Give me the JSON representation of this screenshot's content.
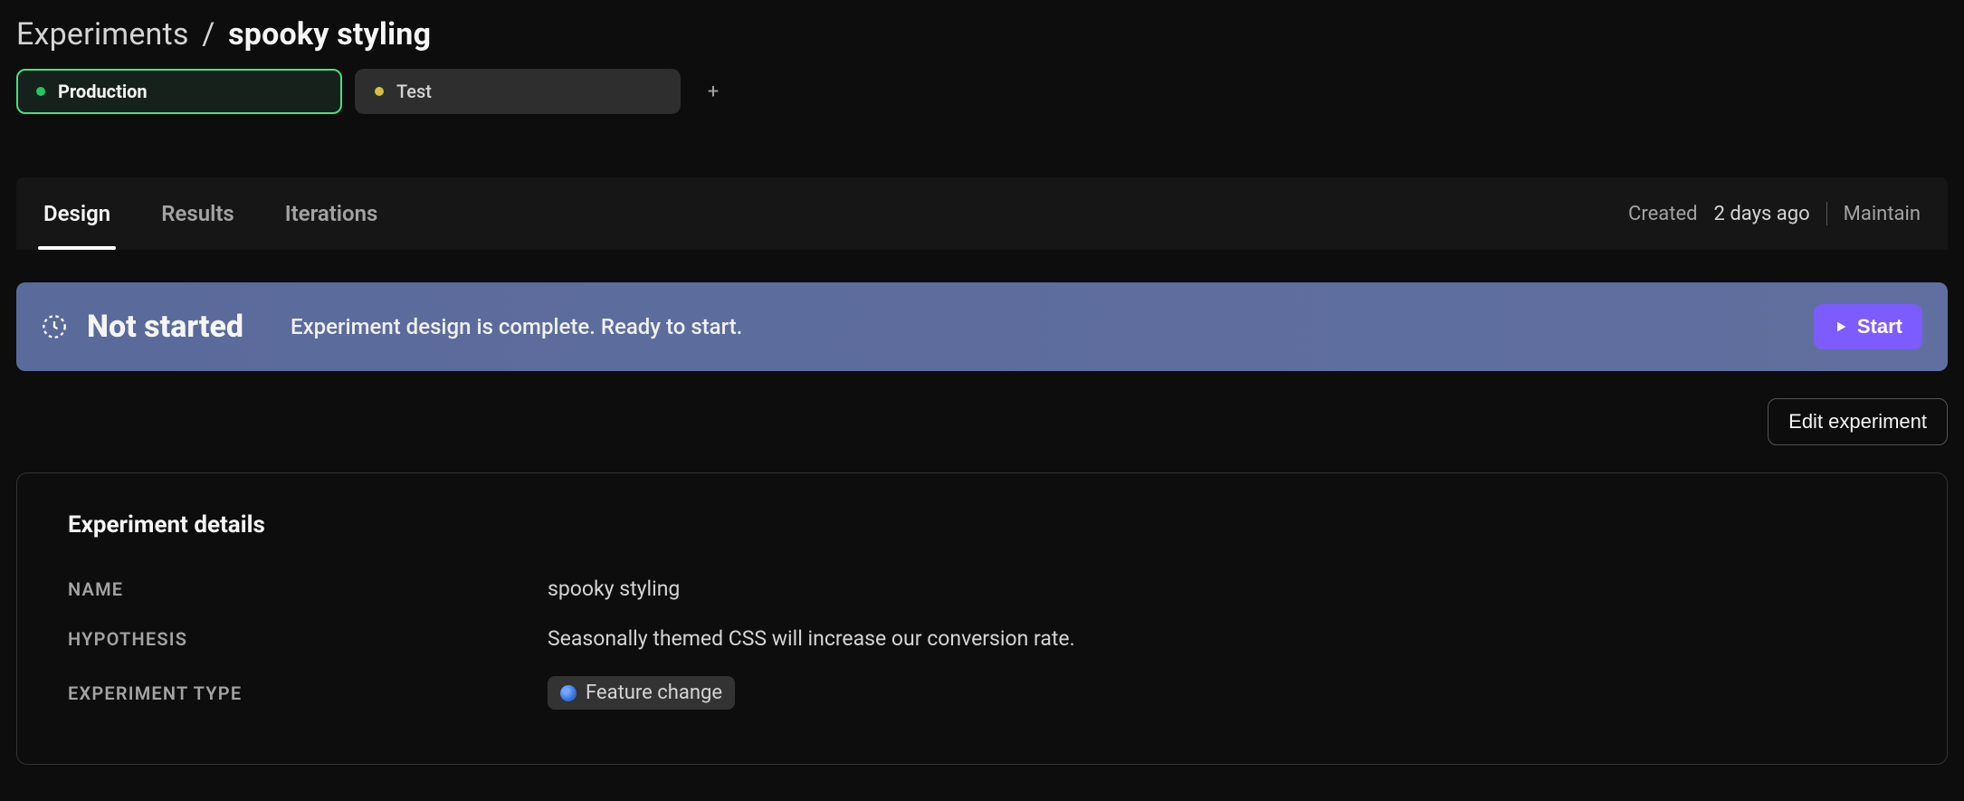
{
  "breadcrumb": {
    "parent": "Experiments",
    "sep": "/",
    "current": "spooky styling"
  },
  "envs": [
    {
      "label": "Production",
      "dot": "green",
      "active": true
    },
    {
      "label": "Test",
      "dot": "yellow",
      "active": false
    }
  ],
  "tabs": [
    {
      "label": "Design",
      "active": true
    },
    {
      "label": "Results",
      "active": false
    },
    {
      "label": "Iterations",
      "active": false
    }
  ],
  "meta": {
    "created_label": "Created",
    "created_value": "2 days ago",
    "maintainer_label": "Maintain"
  },
  "banner": {
    "status_title": "Not started",
    "status_sub": "Experiment design is complete. Ready to start.",
    "start_label": "Start"
  },
  "actions": {
    "edit_label": "Edit experiment"
  },
  "details": {
    "heading": "Experiment details",
    "name_label": "Name",
    "name_value": "spooky styling",
    "hypothesis_label": "Hypothesis",
    "hypothesis_value": "Seasonally themed CSS will increase our conversion rate.",
    "type_label": "Experiment type",
    "type_value": "Feature change"
  }
}
